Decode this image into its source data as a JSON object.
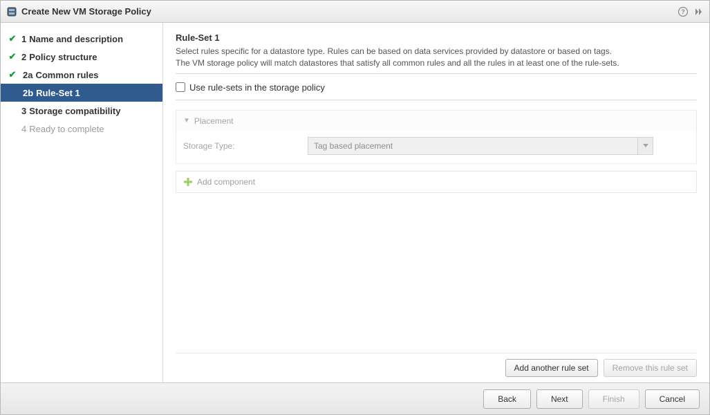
{
  "title": "Create New VM Storage Policy",
  "sidebar": {
    "items": [
      {
        "number": "1",
        "label": "Name and description",
        "done": true
      },
      {
        "number": "2",
        "label": "Policy structure",
        "done": true
      },
      {
        "number": "2a",
        "label": "Common rules",
        "done": true,
        "sub": true
      },
      {
        "number": "2b",
        "label": "Rule-Set 1",
        "selected": true,
        "sub": true
      },
      {
        "number": "3",
        "label": "Storage compatibility"
      },
      {
        "number": "4",
        "label": "Ready to complete",
        "pending": true
      }
    ]
  },
  "main": {
    "heading": "Rule-Set 1",
    "desc_line1": "Select rules specific for a datastore type. Rules can be based on data services provided by datastore or based on tags.",
    "desc_line2": "The VM storage policy will match datastores that satisfy all common rules and all the rules in at least one of the rule-sets.",
    "use_rulesets_label": "Use rule-sets in the storage policy",
    "placement": {
      "title": "Placement",
      "storage_type_label": "Storage Type:",
      "storage_type_value": "Tag based placement"
    },
    "add_component": "Add component",
    "add_ruleset_btn": "Add another rule set",
    "remove_ruleset_btn": "Remove this rule set"
  },
  "footer": {
    "back": "Back",
    "next": "Next",
    "finish": "Finish",
    "cancel": "Cancel"
  }
}
